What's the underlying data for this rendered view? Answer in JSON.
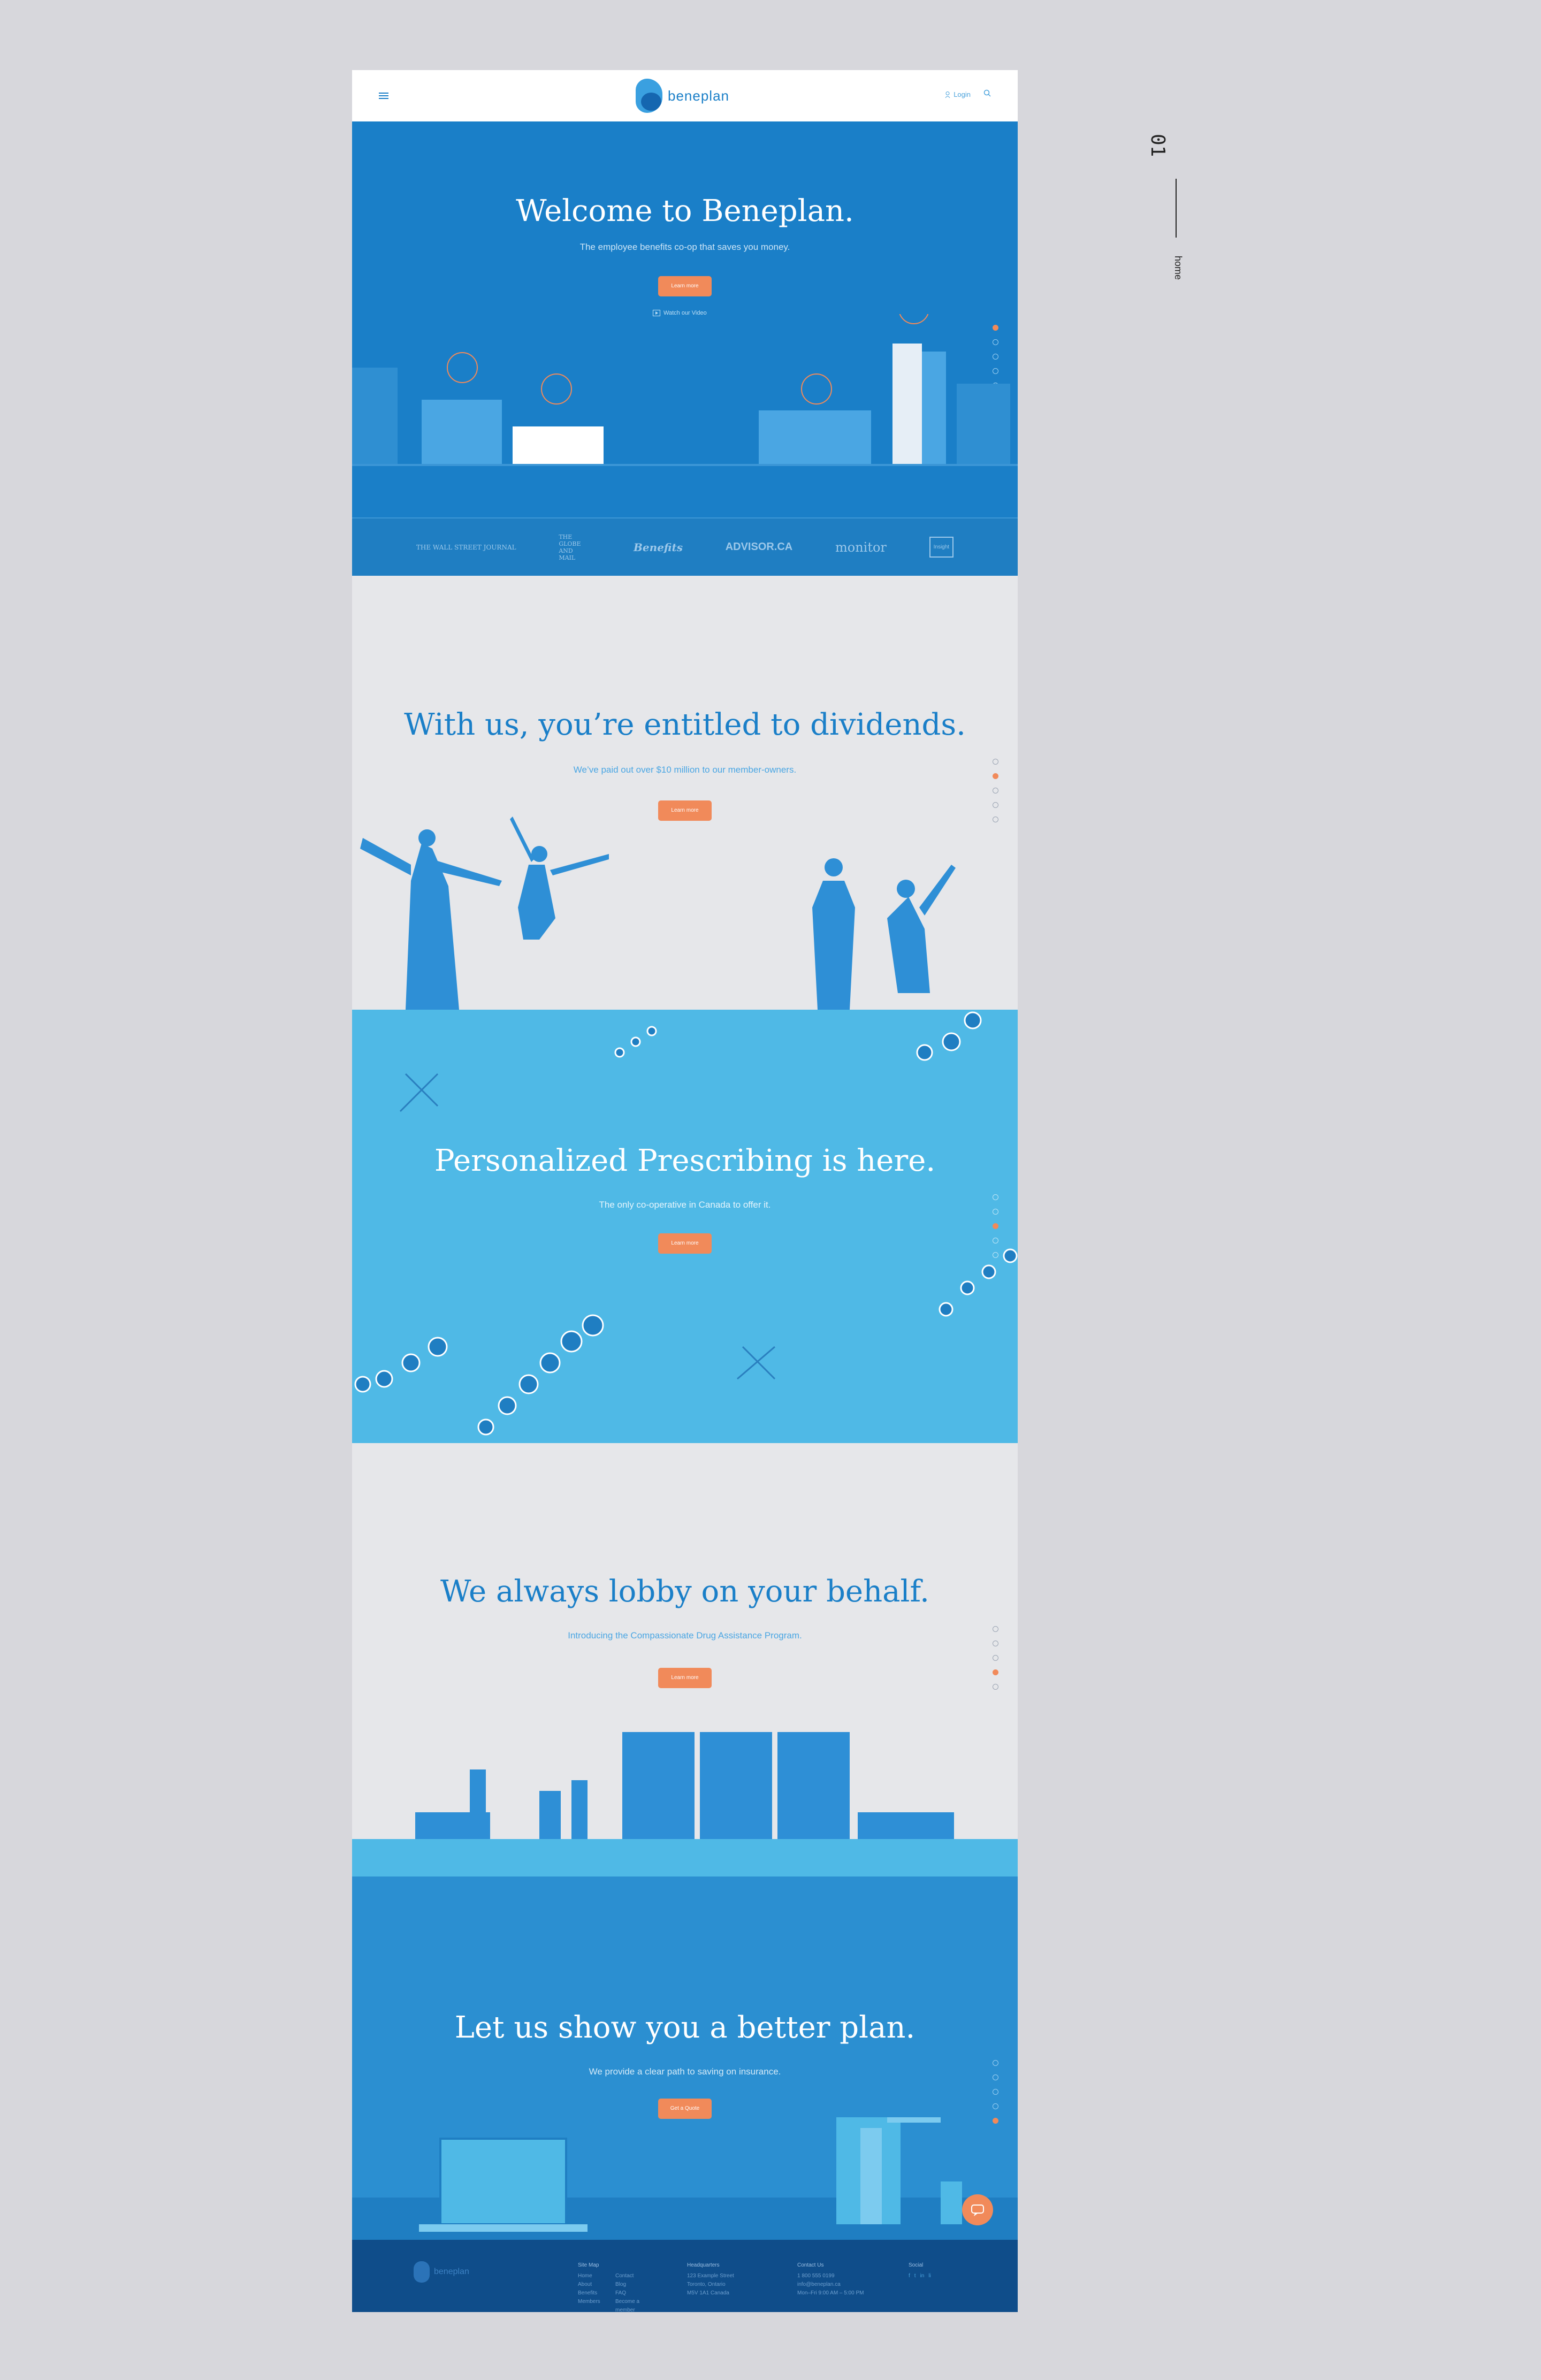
{
  "side": {
    "number": "01",
    "label": "home"
  },
  "header": {
    "brand": "beneplan",
    "login": "Login"
  },
  "hero": {
    "title": "Welcome to Beneplan.",
    "subtitle": "The employee benefits co-op that saves you money.",
    "cta": "Learn more",
    "video": "Watch our Video"
  },
  "press": [
    "THE WALL STREET JOURNAL",
    "THE GLOBE AND MAIL",
    "Benefits",
    "ADVISOR.CA",
    "monitor",
    "Insight"
  ],
  "sections": [
    {
      "title": "With us, you’re entitled to dividends.",
      "subtitle": "We’ve paid out over $10 million to our member-owners.",
      "cta": "Learn more"
    },
    {
      "title": "Personalized Prescribing is here.",
      "subtitle": "The only co-operative in Canada to offer it.",
      "cta": "Learn more"
    },
    {
      "title": "We always lobby on your behalf.",
      "subtitle": "Introducing the Compassionate Drug Assistance Program.",
      "cta": "Learn more"
    },
    {
      "title": "Let us show you a better plan.",
      "subtitle": "We provide a clear path to saving on insurance.",
      "cta": "Get a Quote"
    }
  ],
  "footer": {
    "brand": "beneplan",
    "sitemap_title": "Site Map",
    "sitemap": [
      "Home",
      "About",
      "Benefits",
      "Members",
      "Contact",
      "Blog",
      "FAQ",
      "Become a member"
    ],
    "hq_title": "Headquarters",
    "hq": [
      "123 Example Street",
      "Toronto, Ontario",
      "M5V 1A1 Canada"
    ],
    "contact_title": "Contact Us",
    "contact": [
      "1 800 555 0199",
      "info@beneplan.ca",
      "Mon–Fri 9:00 AM – 5:00 PM"
    ],
    "social_title": "Social",
    "social": [
      "f",
      "t",
      "in",
      "li"
    ]
  },
  "colors": {
    "blue": "#1a7fc8",
    "orange": "#f18a5a",
    "light_blue": "#4fb9e6"
  }
}
